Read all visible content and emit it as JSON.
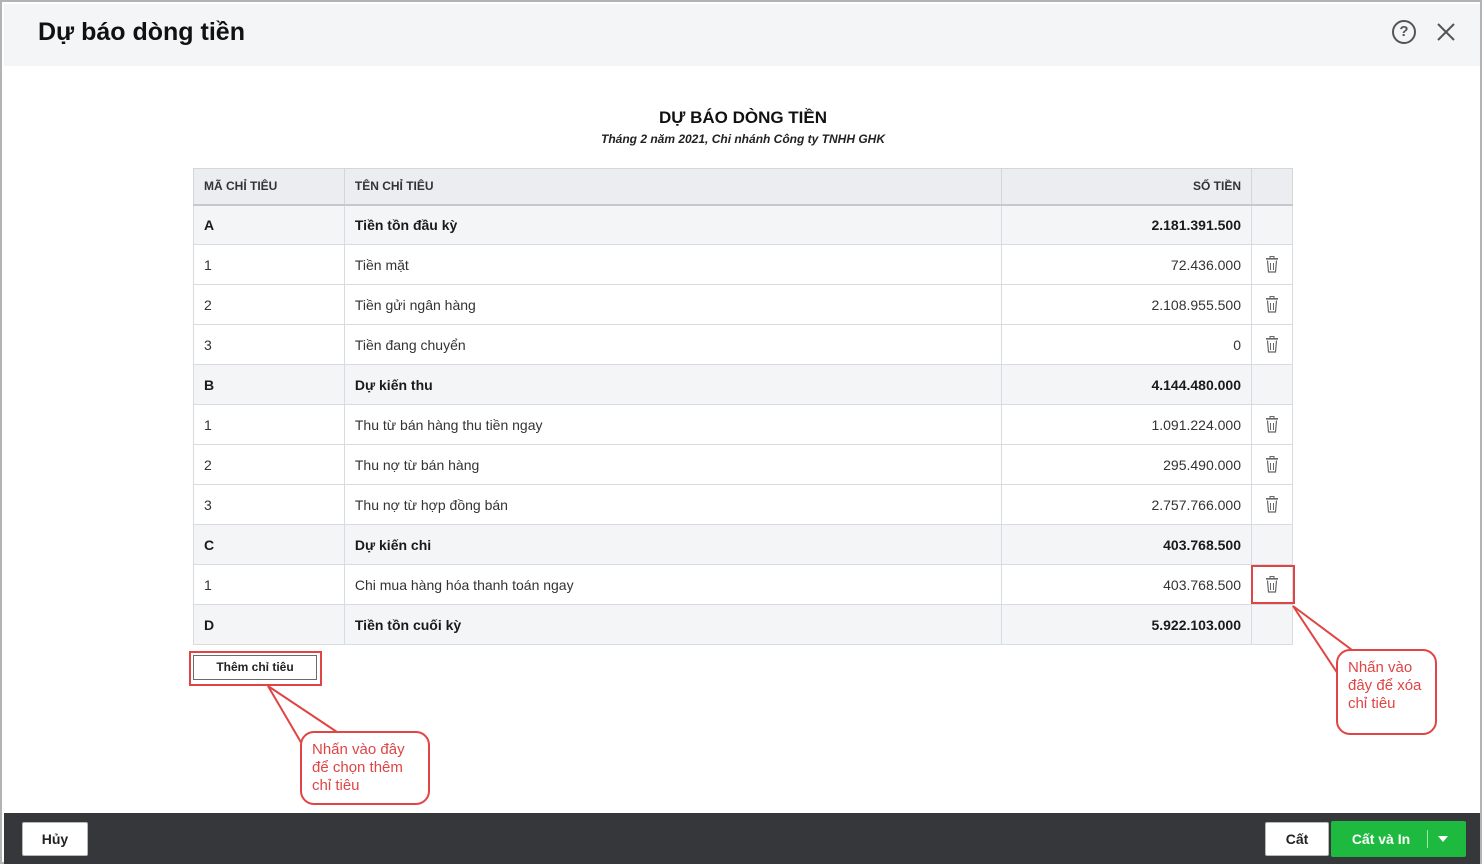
{
  "dialog": {
    "title": "Dự báo dòng tiền",
    "help_glyph": "?"
  },
  "report": {
    "title": "DỰ BÁO DÒNG TIỀN",
    "subtitle": "Tháng 2 năm 2021, Chi nhánh Công ty TNHH GHK"
  },
  "table": {
    "headers": {
      "code": "MÃ CHỈ TIÊU",
      "name": "TÊN CHỈ TIÊU",
      "amount": "SỐ TIỀN"
    },
    "rows": [
      {
        "code": "A",
        "name": "Tiền tồn đầu kỳ",
        "amount": "2.181.391.500",
        "group": true
      },
      {
        "code": "1",
        "name": "Tiền mặt",
        "amount": "72.436.000",
        "group": false
      },
      {
        "code": "2",
        "name": "Tiền gửi ngân hàng",
        "amount": "2.108.955.500",
        "group": false
      },
      {
        "code": "3",
        "name": "Tiền đang chuyển",
        "amount": "0",
        "group": false
      },
      {
        "code": "B",
        "name": "Dự kiến thu",
        "amount": "4.144.480.000",
        "group": true
      },
      {
        "code": "1",
        "name": "Thu từ bán hàng thu tiền ngay",
        "amount": "1.091.224.000",
        "group": false
      },
      {
        "code": "2",
        "name": "Thu nợ từ bán hàng",
        "amount": "295.490.000",
        "group": false
      },
      {
        "code": "3",
        "name": "Thu nợ từ hợp đồng bán",
        "amount": "2.757.766.000",
        "group": false
      },
      {
        "code": "C",
        "name": "Dự kiến chi",
        "amount": "403.768.500",
        "group": true
      },
      {
        "code": "1",
        "name": "Chi mua hàng hóa thanh toán ngay",
        "amount": "403.768.500",
        "group": false
      },
      {
        "code": "D",
        "name": "Tiền tồn cuối kỳ",
        "amount": "5.922.103.000",
        "group": true
      }
    ]
  },
  "add_button_label": "Thêm chỉ tiêu",
  "callouts": {
    "add": "Nhấn vào đây để chọn thêm chỉ tiêu",
    "delete": "Nhấn vào đây để xóa chỉ tiêu"
  },
  "footer": {
    "cancel_label": "Hủy",
    "save_label": "Cất",
    "save_print_label": "Cất và In"
  },
  "colors": {
    "accent_green": "#1dba3f",
    "annotation_red": "#e04444",
    "footer_bg": "#35373b"
  }
}
